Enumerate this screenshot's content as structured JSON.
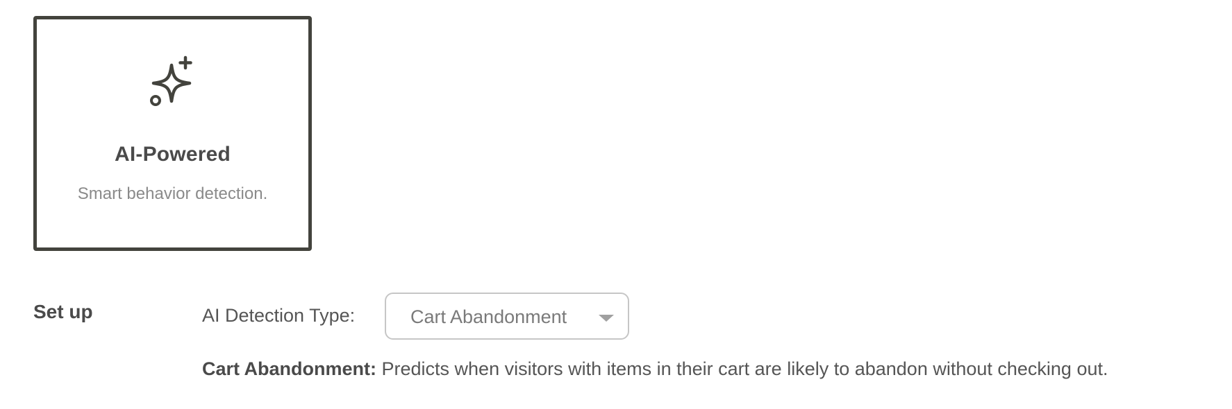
{
  "card": {
    "icon": "sparkles-icon",
    "title": "AI-Powered",
    "description": "Smart behavior detection.",
    "selected": true,
    "border_color": "#43433d"
  },
  "setup": {
    "section_label": "Set up",
    "field_label": "AI Detection Type:",
    "select_value": "Cart Abandonment",
    "help_term": "Cart Abandonment:",
    "help_text": " Predicts when visitors with items in their cart are likely to abandon without checking out."
  }
}
